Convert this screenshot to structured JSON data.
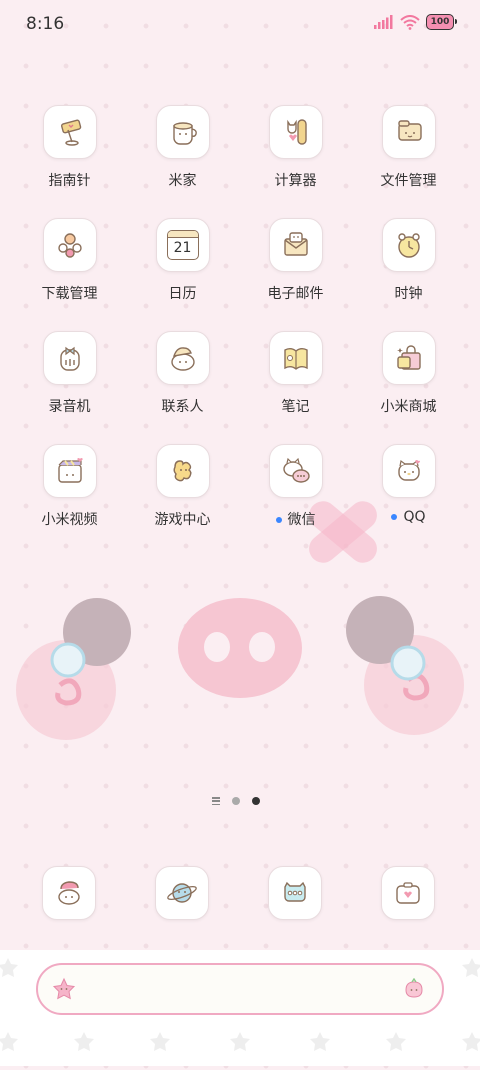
{
  "status_bar": {
    "time": "8:16",
    "battery": "100"
  },
  "apps": [
    {
      "label": "指南针",
      "icon": "compass-icon",
      "badge": false
    },
    {
      "label": "米家",
      "icon": "mi-home-icon",
      "badge": false
    },
    {
      "label": "计算器",
      "icon": "calculator-icon",
      "badge": false
    },
    {
      "label": "文件管理",
      "icon": "file-manager-icon",
      "badge": false
    },
    {
      "label": "下载管理",
      "icon": "download-manager-icon",
      "badge": false
    },
    {
      "label": "日历",
      "icon": "calendar-icon",
      "badge": false,
      "icon_text": "21"
    },
    {
      "label": "电子邮件",
      "icon": "email-icon",
      "badge": false
    },
    {
      "label": "时钟",
      "icon": "clock-icon",
      "badge": false
    },
    {
      "label": "录音机",
      "icon": "recorder-icon",
      "badge": false
    },
    {
      "label": "联系人",
      "icon": "contacts-icon",
      "badge": false
    },
    {
      "label": "笔记",
      "icon": "notes-icon",
      "badge": false
    },
    {
      "label": "小米商城",
      "icon": "mi-store-icon",
      "badge": false
    },
    {
      "label": "小米视频",
      "icon": "mi-video-icon",
      "badge": false
    },
    {
      "label": "游戏中心",
      "icon": "game-center-icon",
      "badge": false
    },
    {
      "label": "微信",
      "icon": "wechat-icon",
      "badge": true
    },
    {
      "label": "QQ",
      "icon": "qq-icon",
      "badge": true
    }
  ],
  "dock": [
    {
      "icon": "phone-icon"
    },
    {
      "icon": "browser-icon"
    },
    {
      "icon": "messages-icon"
    },
    {
      "icon": "camera-icon"
    }
  ],
  "pager": {
    "pages": 2,
    "active": 2
  },
  "colors": {
    "accent_pink": "#f0a9c2",
    "background": "#fbeef2",
    "badge_blue": "#3a86ff"
  }
}
